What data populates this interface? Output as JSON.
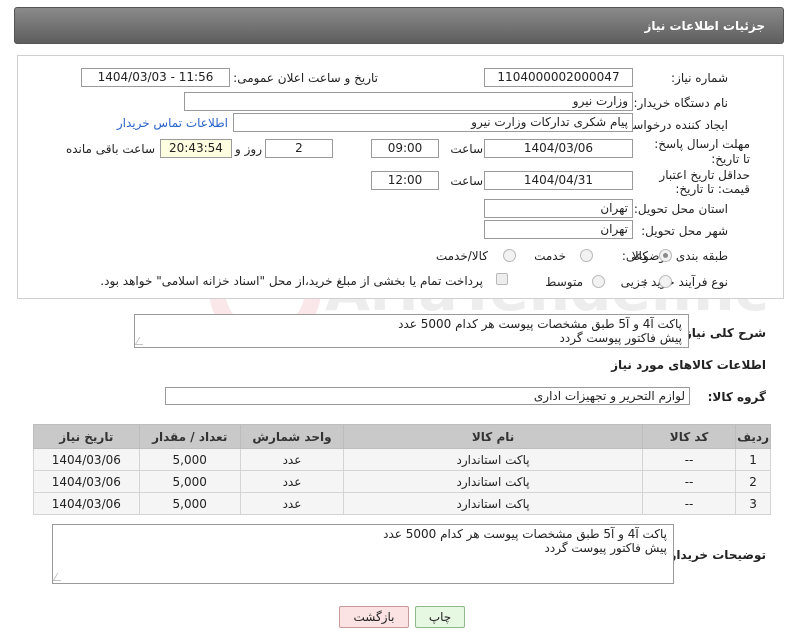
{
  "header": {
    "title": "جزئیات اطلاعات نیاز"
  },
  "fields": {
    "need_number_label": "شماره نیاز:",
    "need_number": "1104000002000047",
    "announce_label": "تاریخ و ساعت اعلان عمومی:",
    "announce_value": "1404/03/03 - 11:56",
    "buyer_org_label": "نام دستگاه خریدار:",
    "buyer_org": "وزارت نیرو",
    "creator_label": "ایجاد کننده درخواست:",
    "creator": "پیام شکری تدارکات وزارت نیرو",
    "contact_link": "اطلاعات تماس خریدار",
    "deadline_label": "مهلت ارسال پاسخ: تا تاریخ:",
    "deadline_date": "1404/03/06",
    "time_label": "ساعت",
    "deadline_time": "09:00",
    "days_value": "2",
    "days_label": "روز و",
    "remaining_time": "20:43:54",
    "remaining_label": "ساعت باقی مانده",
    "price_valid_label": "حداقل تاریخ اعتبار قیمت: تا تاریخ:",
    "price_valid_date": "1404/04/31",
    "price_valid_time": "12:00",
    "province_label": "استان محل تحویل:",
    "province": "تهران",
    "city_label": "شهر محل تحویل:",
    "city": "تهران",
    "category_label": "طبقه بندی موضوعی:",
    "category_options": [
      "کالا",
      "خدمت",
      "کالا/خدمت"
    ],
    "purchase_type_label": "نوع فرآیند خرید :",
    "purchase_options": [
      "جزیی",
      "متوسط"
    ],
    "payment_note": "پرداخت تمام یا بخشی از مبلغ خرید،از محل \"اسناد خزانه اسلامی\" خواهد بود."
  },
  "description": {
    "label": "شرح کلی نیاز:",
    "line1": "پاکت آ4 و آ5 طبق مشخصات پیوست هر کدام 5000 عدد",
    "line2": "پیش فاکتور پیوست گردد"
  },
  "goods": {
    "section_title": "اطلاعات کالاهای مورد نیاز",
    "group_label": "گروه کالا:",
    "group_value": "لوازم التحریر و تجهیزات اداری"
  },
  "table": {
    "headers": [
      "ردیف",
      "کد کالا",
      "نام کالا",
      "واحد شمارش",
      "تعداد / مقدار",
      "تاریخ نیاز"
    ],
    "rows": [
      [
        "1",
        "--",
        "پاکت استاندارد",
        "عدد",
        "5,000",
        "1404/03/06"
      ],
      [
        "2",
        "--",
        "پاکت استاندارد",
        "عدد",
        "5,000",
        "1404/03/06"
      ],
      [
        "3",
        "--",
        "پاکت استاندارد",
        "عدد",
        "5,000",
        "1404/03/06"
      ]
    ]
  },
  "buyer_notes": {
    "label": "توضیحات خریدار:",
    "line1": "پاکت آ4 و آ5 طبق مشخصات پیوست هر کدام 5000 عدد",
    "line2": "پیش فاکتور پیوست گردد"
  },
  "buttons": {
    "print": "چاپ",
    "back": "بازگشت"
  },
  "watermark_text": "AriaTender.net"
}
